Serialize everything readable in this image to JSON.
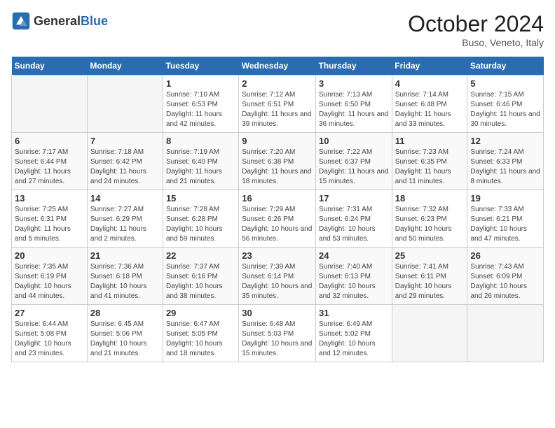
{
  "header": {
    "logo": {
      "text_general": "General",
      "text_blue": "Blue"
    },
    "month": "October 2024",
    "location": "Buso, Veneto, Italy"
  },
  "days_of_week": [
    "Sunday",
    "Monday",
    "Tuesday",
    "Wednesday",
    "Thursday",
    "Friday",
    "Saturday"
  ],
  "weeks": [
    [
      null,
      null,
      {
        "day": "1",
        "sunrise": "Sunrise: 7:10 AM",
        "sunset": "Sunset: 6:53 PM",
        "daylight": "Daylight: 11 hours and 42 minutes."
      },
      {
        "day": "2",
        "sunrise": "Sunrise: 7:12 AM",
        "sunset": "Sunset: 6:51 PM",
        "daylight": "Daylight: 11 hours and 39 minutes."
      },
      {
        "day": "3",
        "sunrise": "Sunrise: 7:13 AM",
        "sunset": "Sunset: 6:50 PM",
        "daylight": "Daylight: 11 hours and 36 minutes."
      },
      {
        "day": "4",
        "sunrise": "Sunrise: 7:14 AM",
        "sunset": "Sunset: 6:48 PM",
        "daylight": "Daylight: 11 hours and 33 minutes."
      },
      {
        "day": "5",
        "sunrise": "Sunrise: 7:15 AM",
        "sunset": "Sunset: 6:46 PM",
        "daylight": "Daylight: 11 hours and 30 minutes."
      }
    ],
    [
      {
        "day": "6",
        "sunrise": "Sunrise: 7:17 AM",
        "sunset": "Sunset: 6:44 PM",
        "daylight": "Daylight: 11 hours and 27 minutes."
      },
      {
        "day": "7",
        "sunrise": "Sunrise: 7:18 AM",
        "sunset": "Sunset: 6:42 PM",
        "daylight": "Daylight: 11 hours and 24 minutes."
      },
      {
        "day": "8",
        "sunrise": "Sunrise: 7:19 AM",
        "sunset": "Sunset: 6:40 PM",
        "daylight": "Daylight: 11 hours and 21 minutes."
      },
      {
        "day": "9",
        "sunrise": "Sunrise: 7:20 AM",
        "sunset": "Sunset: 6:38 PM",
        "daylight": "Daylight: 11 hours and 18 minutes."
      },
      {
        "day": "10",
        "sunrise": "Sunrise: 7:22 AM",
        "sunset": "Sunset: 6:37 PM",
        "daylight": "Daylight: 11 hours and 15 minutes."
      },
      {
        "day": "11",
        "sunrise": "Sunrise: 7:23 AM",
        "sunset": "Sunset: 6:35 PM",
        "daylight": "Daylight: 11 hours and 11 minutes."
      },
      {
        "day": "12",
        "sunrise": "Sunrise: 7:24 AM",
        "sunset": "Sunset: 6:33 PM",
        "daylight": "Daylight: 11 hours and 8 minutes."
      }
    ],
    [
      {
        "day": "13",
        "sunrise": "Sunrise: 7:25 AM",
        "sunset": "Sunset: 6:31 PM",
        "daylight": "Daylight: 11 hours and 5 minutes."
      },
      {
        "day": "14",
        "sunrise": "Sunrise: 7:27 AM",
        "sunset": "Sunset: 6:29 PM",
        "daylight": "Daylight: 11 hours and 2 minutes."
      },
      {
        "day": "15",
        "sunrise": "Sunrise: 7:28 AM",
        "sunset": "Sunset: 6:28 PM",
        "daylight": "Daylight: 10 hours and 59 minutes."
      },
      {
        "day": "16",
        "sunrise": "Sunrise: 7:29 AM",
        "sunset": "Sunset: 6:26 PM",
        "daylight": "Daylight: 10 hours and 56 minutes."
      },
      {
        "day": "17",
        "sunrise": "Sunrise: 7:31 AM",
        "sunset": "Sunset: 6:24 PM",
        "daylight": "Daylight: 10 hours and 53 minutes."
      },
      {
        "day": "18",
        "sunrise": "Sunrise: 7:32 AM",
        "sunset": "Sunset: 6:23 PM",
        "daylight": "Daylight: 10 hours and 50 minutes."
      },
      {
        "day": "19",
        "sunrise": "Sunrise: 7:33 AM",
        "sunset": "Sunset: 6:21 PM",
        "daylight": "Daylight: 10 hours and 47 minutes."
      }
    ],
    [
      {
        "day": "20",
        "sunrise": "Sunrise: 7:35 AM",
        "sunset": "Sunset: 6:19 PM",
        "daylight": "Daylight: 10 hours and 44 minutes."
      },
      {
        "day": "21",
        "sunrise": "Sunrise: 7:36 AM",
        "sunset": "Sunset: 6:18 PM",
        "daylight": "Daylight: 10 hours and 41 minutes."
      },
      {
        "day": "22",
        "sunrise": "Sunrise: 7:37 AM",
        "sunset": "Sunset: 6:16 PM",
        "daylight": "Daylight: 10 hours and 38 minutes."
      },
      {
        "day": "23",
        "sunrise": "Sunrise: 7:39 AM",
        "sunset": "Sunset: 6:14 PM",
        "daylight": "Daylight: 10 hours and 35 minutes."
      },
      {
        "day": "24",
        "sunrise": "Sunrise: 7:40 AM",
        "sunset": "Sunset: 6:13 PM",
        "daylight": "Daylight: 10 hours and 32 minutes."
      },
      {
        "day": "25",
        "sunrise": "Sunrise: 7:41 AM",
        "sunset": "Sunset: 6:11 PM",
        "daylight": "Daylight: 10 hours and 29 minutes."
      },
      {
        "day": "26",
        "sunrise": "Sunrise: 7:43 AM",
        "sunset": "Sunset: 6:09 PM",
        "daylight": "Daylight: 10 hours and 26 minutes."
      }
    ],
    [
      {
        "day": "27",
        "sunrise": "Sunrise: 6:44 AM",
        "sunset": "Sunset: 5:08 PM",
        "daylight": "Daylight: 10 hours and 23 minutes."
      },
      {
        "day": "28",
        "sunrise": "Sunrise: 6:45 AM",
        "sunset": "Sunset: 5:06 PM",
        "daylight": "Daylight: 10 hours and 21 minutes."
      },
      {
        "day": "29",
        "sunrise": "Sunrise: 6:47 AM",
        "sunset": "Sunset: 5:05 PM",
        "daylight": "Daylight: 10 hours and 18 minutes."
      },
      {
        "day": "30",
        "sunrise": "Sunrise: 6:48 AM",
        "sunset": "Sunset: 5:03 PM",
        "daylight": "Daylight: 10 hours and 15 minutes."
      },
      {
        "day": "31",
        "sunrise": "Sunrise: 6:49 AM",
        "sunset": "Sunset: 5:02 PM",
        "daylight": "Daylight: 10 hours and 12 minutes."
      },
      null,
      null
    ]
  ]
}
